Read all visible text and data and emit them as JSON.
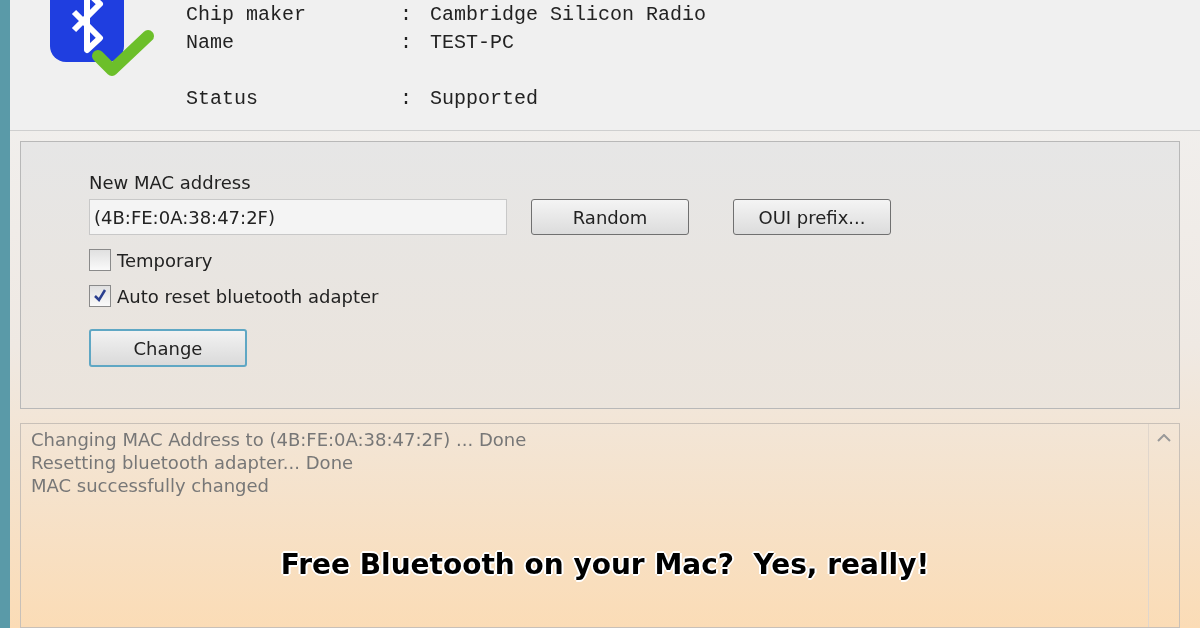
{
  "device_info": [
    {
      "label": "Chip maker",
      "separator": ":",
      "value": "Cambridge Silicon Radio"
    },
    {
      "label": "Name",
      "separator": ":",
      "value": "TEST-PC"
    },
    {
      "label": "Status",
      "separator": ":",
      "value": "Supported"
    }
  ],
  "mac": {
    "label": "New MAC address",
    "value": "(4B:FE:0A:38:47:2F)"
  },
  "buttons": [
    "Random",
    "OUI prefix..."
  ],
  "options": [
    {
      "label": "Temporary",
      "checked": false
    },
    {
      "label": "Auto reset bluetooth adapter",
      "checked": true
    }
  ],
  "change_button": "Change",
  "log": [
    "Changing MAC Address to (4B:FE:0A:38:47:2F) ... Done",
    "Resetting bluetooth adapter... Done",
    "MAC successfully changed"
  ],
  "caption": "Free Bluetooth on your Mac?  Yes, really!"
}
